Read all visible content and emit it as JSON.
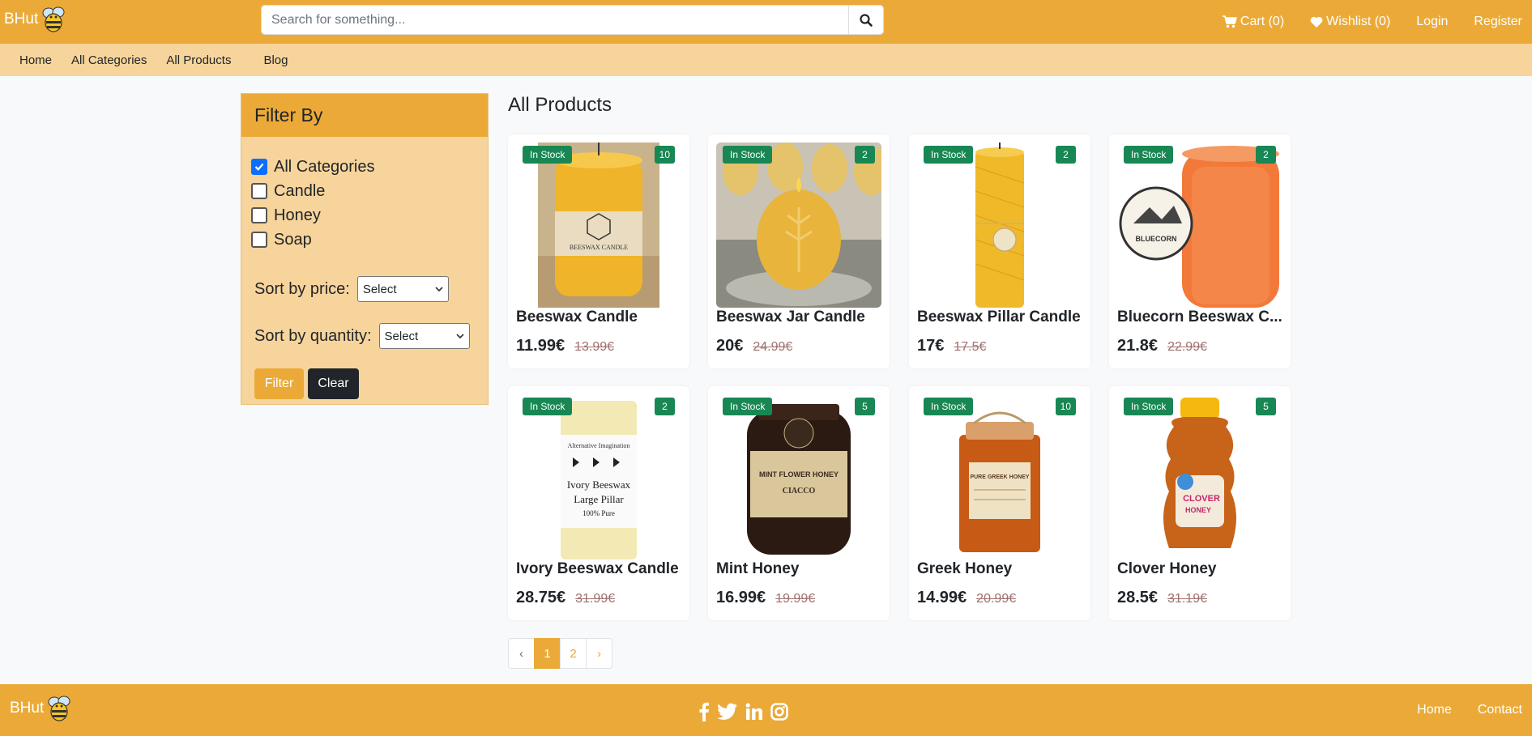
{
  "brand": {
    "name": "BHut"
  },
  "search": {
    "placeholder": "Search for something..."
  },
  "nav_right": {
    "cart": "Cart (0)",
    "wishlist": "Wishlist (0)",
    "login": "Login",
    "register": "Register"
  },
  "subnav": [
    "Home",
    "All Categories",
    "All Products",
    "Blog"
  ],
  "filter": {
    "title": "Filter By",
    "categories": [
      {
        "label": "All Categories",
        "checked": true
      },
      {
        "label": "Candle",
        "checked": false
      },
      {
        "label": "Honey",
        "checked": false
      },
      {
        "label": "Soap",
        "checked": false
      }
    ],
    "sort_price_label": "Sort by price:",
    "sort_price_value": "Select",
    "sort_quantity_label": "Sort by quantity:",
    "sort_quantity_value": "Select",
    "filter_button": "Filter",
    "clear_button": "Clear"
  },
  "main": {
    "title": "All Products"
  },
  "products": [
    {
      "name": "Beeswax Candle",
      "price": "11.99€",
      "old_price": "13.99€",
      "stock": "In Stock",
      "qty": "10"
    },
    {
      "name": "Beeswax Jar Candle",
      "price": "20€",
      "old_price": "24.99€",
      "stock": "In Stock",
      "qty": "2"
    },
    {
      "name": "Beeswax Pillar Candle",
      "price": "17€",
      "old_price": "17.5€",
      "stock": "In Stock",
      "qty": "2"
    },
    {
      "name": "Bluecorn Beeswax C...",
      "price": "21.8€",
      "old_price": "22.99€",
      "stock": "In Stock",
      "qty": "2"
    },
    {
      "name": "Ivory Beeswax Candle",
      "price": "28.75€",
      "old_price": "31.99€",
      "stock": "In Stock",
      "qty": "2"
    },
    {
      "name": "Mint Honey",
      "price": "16.99€",
      "old_price": "19.99€",
      "stock": "In Stock",
      "qty": "5"
    },
    {
      "name": "Greek Honey",
      "price": "14.99€",
      "old_price": "20.99€",
      "stock": "In Stock",
      "qty": "10"
    },
    {
      "name": "Clover Honey",
      "price": "28.5€",
      "old_price": "31.19€",
      "stock": "In Stock",
      "qty": "5"
    }
  ],
  "product_image_text": {
    "beeswax_candle": "BEESWAX CANDLE",
    "bluecorn": "BLUECORN",
    "ivory_1": "Alternative Imagination",
    "ivory_2": "Ivory Beeswax",
    "ivory_3": "Large Pillar",
    "ivory_4": "100% Pure",
    "mint_1": "MINT FLOWER HONEY",
    "mint_2": "CIACCO",
    "greek": "PURE GREEK HONEY",
    "clover_1": "CLOVER",
    "clover_2": "HONEY"
  },
  "pagination": {
    "prev": "‹",
    "pages": [
      "1",
      "2"
    ],
    "next": "›",
    "active": "1"
  },
  "footer": {
    "brand": "BHut",
    "links": [
      "Home",
      "Contact"
    ]
  },
  "colors": {
    "primary": "#ebaa37",
    "secondary": "#f7d49b",
    "stock_badge": "#198754",
    "dark": "#212529"
  },
  "icons": [
    "bee-logo-icon",
    "search-icon",
    "cart-icon",
    "heart-icon",
    "facebook-icon",
    "twitter-icon",
    "linkedin-icon",
    "instagram-icon"
  ]
}
